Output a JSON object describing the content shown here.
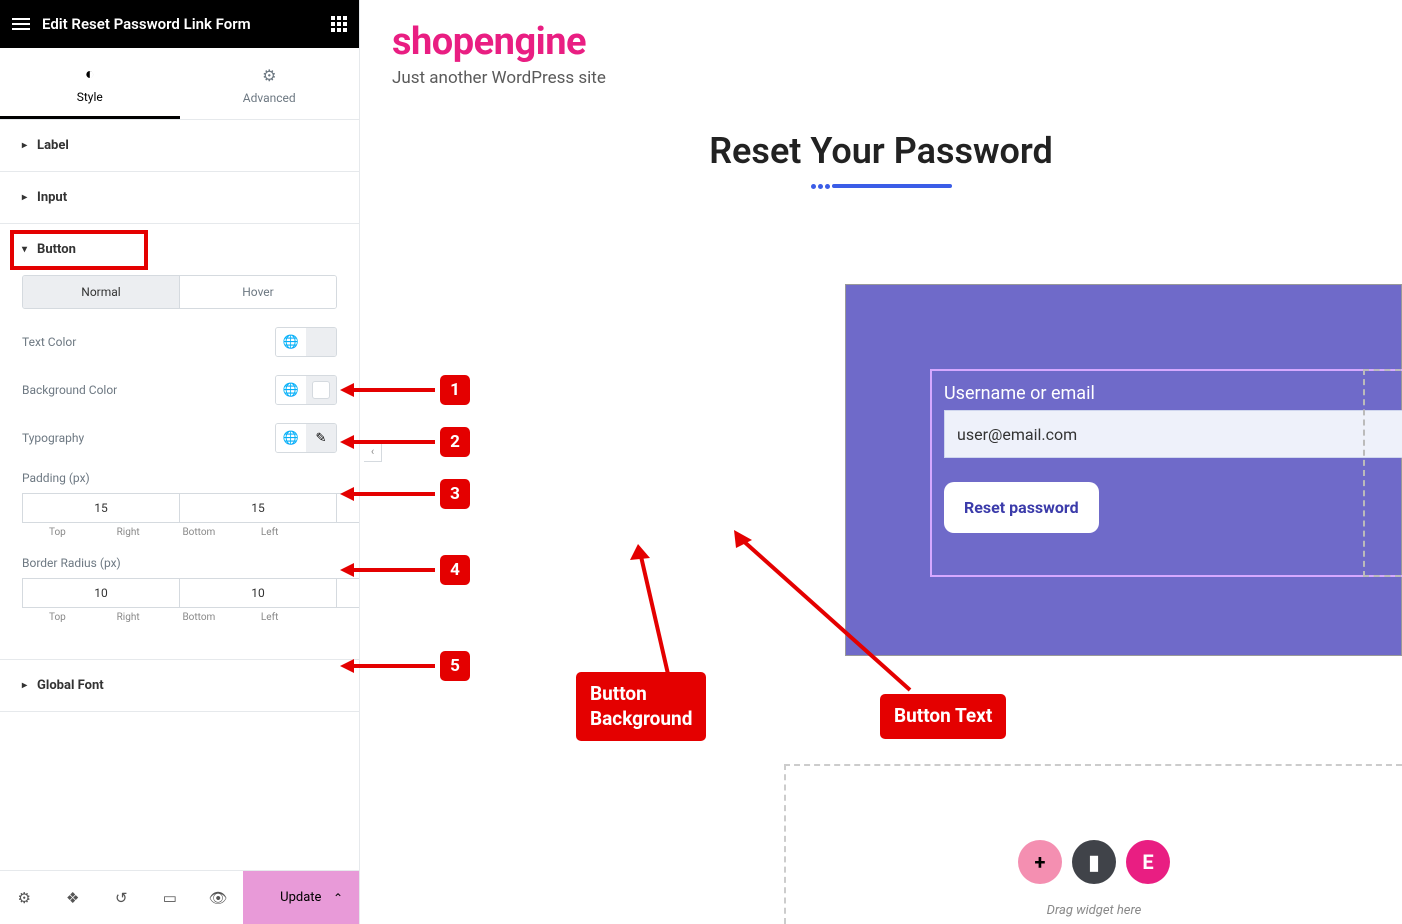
{
  "header": {
    "title": "Edit Reset Password Link Form"
  },
  "tabs": {
    "style": "Style",
    "advanced": "Advanced"
  },
  "sections": {
    "label": "Label",
    "input": "Input",
    "button": "Button",
    "globalFont": "Global Font"
  },
  "button_panel": {
    "normal": "Normal",
    "hover": "Hover",
    "textColor": "Text Color",
    "bgColor": "Background Color",
    "typography": "Typography",
    "paddingLabel": "Padding (px)",
    "radiusLabel": "Border Radius (px)",
    "padding": {
      "top": "15",
      "right": "15",
      "bottom": "15",
      "left": "15"
    },
    "radius": {
      "top": "10",
      "right": "10",
      "bottom": "10",
      "left": "10"
    },
    "dims": {
      "top": "Top",
      "right": "Right",
      "bottom": "Bottom",
      "left": "Left"
    },
    "textColorSwatch": "#6f6ac9",
    "bgColorSwatch": "#ffffff"
  },
  "footer": {
    "update": "Update"
  },
  "site": {
    "title": "shopengine",
    "tag": "Just another WordPress site",
    "heading": "Reset Your Password",
    "formLabel": "Username or email",
    "formValue": "user@email.com",
    "resetBtn": "Reset password",
    "dragText": "Drag widget here"
  },
  "callouts": {
    "n1": "1",
    "n2": "2",
    "n3": "3",
    "n4": "4",
    "n5": "5",
    "btnBg": "Button\nBackground",
    "btnText": "Button Text"
  }
}
